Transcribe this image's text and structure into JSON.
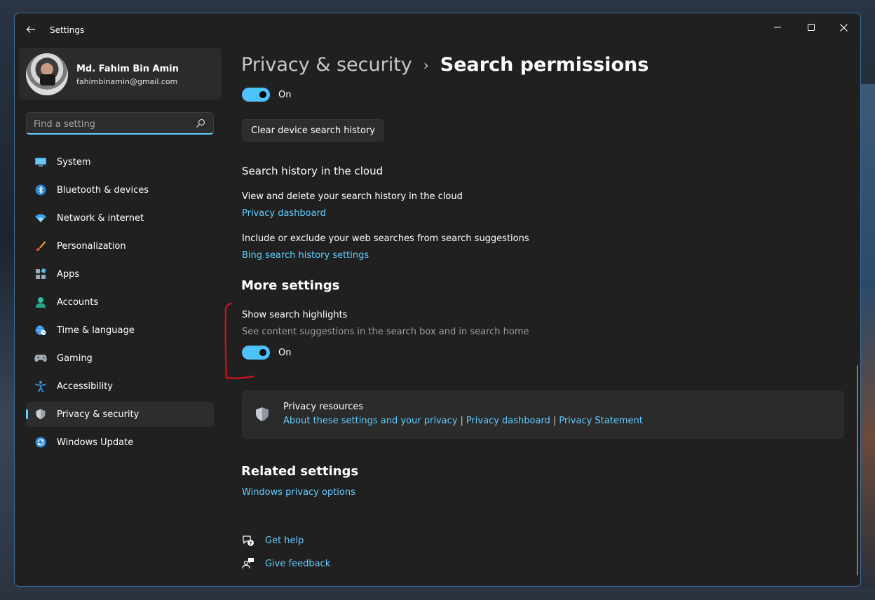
{
  "window": {
    "title": "Settings"
  },
  "profile": {
    "name": "Md. Fahim Bin Amin",
    "email": "fahimbinamin@gmail.com"
  },
  "search": {
    "placeholder": "Find a setting"
  },
  "sidebar": {
    "items": [
      {
        "label": "System",
        "icon": "monitor-icon"
      },
      {
        "label": "Bluetooth & devices",
        "icon": "bluetooth-icon"
      },
      {
        "label": "Network & internet",
        "icon": "wifi-icon"
      },
      {
        "label": "Personalization",
        "icon": "brush-icon"
      },
      {
        "label": "Apps",
        "icon": "apps-icon"
      },
      {
        "label": "Accounts",
        "icon": "person-icon"
      },
      {
        "label": "Time & language",
        "icon": "globe-clock-icon"
      },
      {
        "label": "Gaming",
        "icon": "gamepad-icon"
      },
      {
        "label": "Accessibility",
        "icon": "accessibility-icon"
      },
      {
        "label": "Privacy & security",
        "icon": "shield-icon",
        "active": true
      },
      {
        "label": "Windows Update",
        "icon": "update-icon"
      }
    ]
  },
  "breadcrumb": {
    "parent": "Privacy & security",
    "separator": "›",
    "current": "Search permissions"
  },
  "device_history": {
    "toggle_label": "On",
    "toggle_on": true,
    "clear_button": "Clear device search history"
  },
  "cloud": {
    "heading": "Search history in the cloud",
    "view_text": "View and delete your search history in the cloud",
    "view_link": "Privacy dashboard",
    "include_text": "Include or exclude your web searches from search suggestions",
    "include_link": "Bing search history settings"
  },
  "more_settings": {
    "heading": "More settings",
    "highlights_title": "Show search highlights",
    "highlights_desc": "See content suggestions in the search box and in search home",
    "toggle_label": "On",
    "toggle_on": true
  },
  "resources": {
    "title": "Privacy resources",
    "links": [
      "About these settings and your privacy",
      "Privacy dashboard",
      "Privacy Statement"
    ],
    "separator": "|"
  },
  "related": {
    "heading": "Related settings",
    "link": "Windows privacy options"
  },
  "help": {
    "get_help": "Get help",
    "give_feedback": "Give feedback"
  },
  "colors": {
    "accent": "#60cdff",
    "toggle": "#4cc2ff",
    "annotation": "#d0131a",
    "window_bg": "#202020"
  }
}
